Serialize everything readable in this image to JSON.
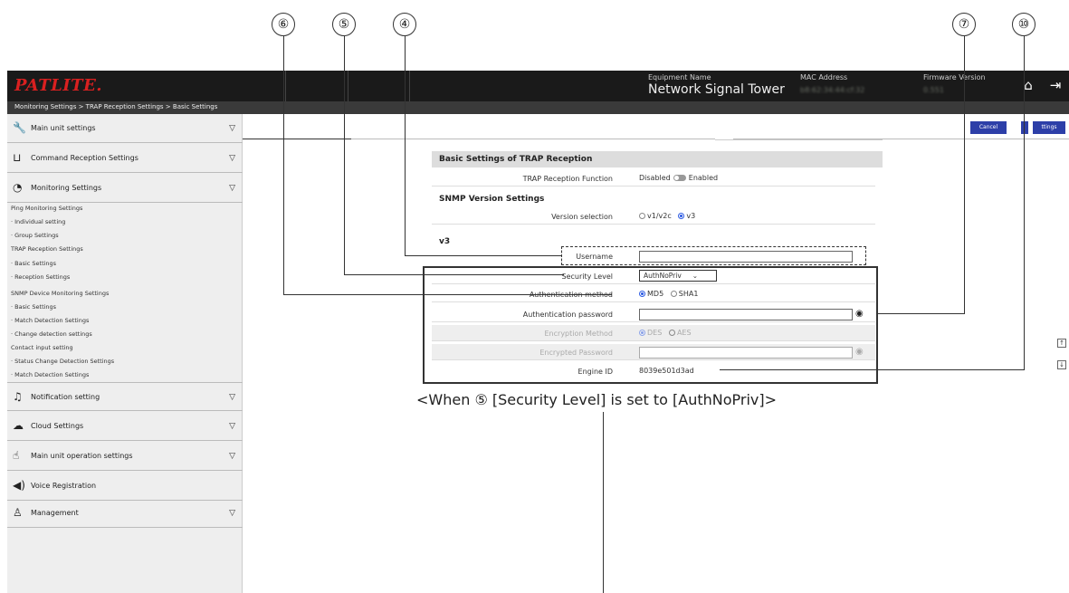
{
  "callouts": {
    "n6": "⑥",
    "n5": "⑤",
    "n4": "④",
    "n7": "⑦",
    "n10": "⑩"
  },
  "header": {
    "logo": "PATLITE.",
    "equipment_label": "Equipment Name",
    "equipment_value": "Network Signal Tower",
    "mac_label": "MAC Address",
    "mac_value": "b8:62:34:44:cf:32",
    "firmware_label": "Firmware Version",
    "firmware_value": "0.551",
    "home_icon": "home-icon",
    "logout_icon": "logout-icon"
  },
  "breadcrumb": "Monitoring Settings > TRAP Reception Settings > Basic Settings",
  "sidebar": {
    "items": [
      {
        "label": "Main unit settings",
        "icon": "wrench-icon"
      },
      {
        "label": "Command Reception Settings",
        "icon": "inbox-icon"
      },
      {
        "label": "Monitoring Settings",
        "icon": "gauge-icon"
      },
      {
        "label": "Notification setting",
        "icon": "bell-icon"
      },
      {
        "label": "Cloud Settings",
        "icon": "cloud-icon"
      },
      {
        "label": "Main unit operation settings",
        "icon": "hand-icon"
      },
      {
        "label": "Voice Registration",
        "icon": "speaker-icon"
      },
      {
        "label": "Management",
        "icon": "user-icon"
      }
    ],
    "sub": [
      "Ping Monitoring Settings",
      "· Individual setting",
      "· Group Settings",
      "TRAP Reception Settings",
      "· Basic Settings",
      "· Reception Settings",
      "SNMP Device Monitoring Settings",
      "· Basic Settings",
      "· Match Detection Settings",
      "· Change detection settings",
      "Contact input setting",
      "· Status Change Detection Settings",
      "· Match Detection Settings"
    ]
  },
  "actions": {
    "cancel": "Cancel",
    "save": "ttings"
  },
  "form": {
    "title": "Basic Settings of TRAP Reception",
    "trap_label": "TRAP Reception Function",
    "trap_disabled": "Disabled",
    "trap_enabled": "Enabled",
    "snmp_section": "SNMP Version Settings",
    "version_label": "Version selection",
    "version_opt1": "v1/v2c",
    "version_opt2": "v3",
    "v3_section": "v3",
    "username_label": "Username",
    "security_label": "Security Level",
    "security_value": "AuthNoPriv",
    "auth_method_label": "Authentication method",
    "auth_opt1": "MD5",
    "auth_opt2": "SHA1",
    "auth_pw_label": "Authentication password",
    "enc_method_label": "Encryption Method",
    "enc_opt1": "DES",
    "enc_opt2": "AES",
    "enc_pw_label": "Encrypted Password",
    "engine_label": "Engine ID",
    "engine_value": "8039e501d3ad"
  },
  "caption": "<When ⑤ [Security Level] is set to [AuthNoPriv]>"
}
